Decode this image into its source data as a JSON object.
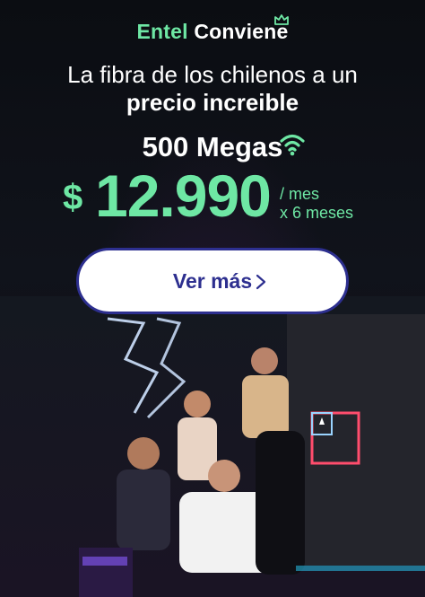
{
  "brand": {
    "part1": "Entel",
    "part2": "Conviene"
  },
  "headline": {
    "line1": "La fibra de los chilenos a un",
    "line2": "precio increible"
  },
  "plan": {
    "speed": "500 Megas"
  },
  "price": {
    "currency": "$",
    "amount": "12.990",
    "per_line1": "/ mes",
    "per_line2": "x 6 meses"
  },
  "cta": {
    "label": "Ver más"
  },
  "colors": {
    "accent": "#6ee7a4",
    "button_text": "#2d2f8f",
    "background": "#0b0d12"
  },
  "icons": {
    "crown": "crown-icon",
    "wifi": "wifi-icon",
    "chevron": "chevron-right-icon"
  }
}
